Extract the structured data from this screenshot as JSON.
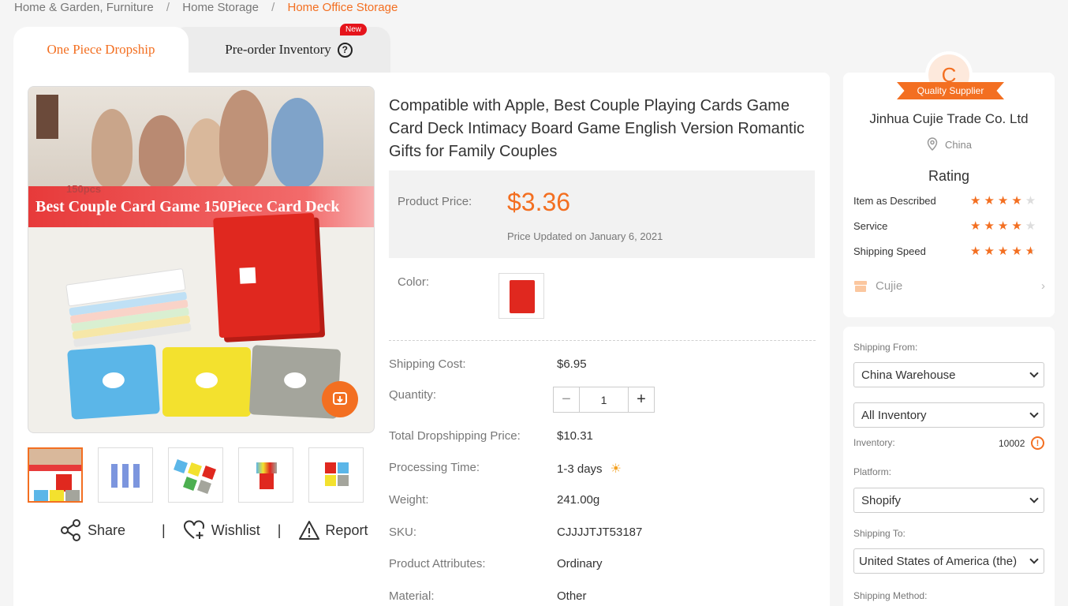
{
  "breadcrumb": {
    "items": [
      "Home & Garden, Furniture",
      "Home Storage"
    ],
    "current": "Home Office Storage",
    "separator": "/"
  },
  "tabs": {
    "dropship": "One Piece Dropship",
    "preorder": "Pre-order Inventory",
    "new_badge": "New"
  },
  "gallery": {
    "banner_text": "Best Couple Card Game 150Piece Card Deck",
    "banner_sub": "150pcs",
    "thumbnails": [
      "thumb-1",
      "thumb-2",
      "thumb-3",
      "thumb-4",
      "thumb-5"
    ]
  },
  "actions": {
    "share": "Share",
    "wishlist": "Wishlist",
    "report": "Report",
    "divider": "|"
  },
  "product": {
    "title": "Compatible with Apple, Best Couple Playing Cards Game Card Deck Intimacy Board Game English Version Romantic Gifts for Family Couples",
    "price_label": "Product Price:",
    "price": "$3.36",
    "price_updated": "Price Updated on January 6, 2021",
    "color_label": "Color:",
    "shipping_cost_label": "Shipping Cost:",
    "shipping_cost": "$6.95",
    "quantity_label": "Quantity:",
    "quantity": "1",
    "total_label": "Total Dropshipping Price:",
    "total": "$10.31",
    "processing_label": "Processing Time:",
    "processing": "1-3 days",
    "weight_label": "Weight:",
    "weight": "241.00g",
    "sku_label": "SKU:",
    "sku": "CJJJJTJT53187",
    "attributes_label": "Product Attributes:",
    "attributes": "Ordinary",
    "material_label": "Material:",
    "material": "Other"
  },
  "supplier": {
    "badge_letter": "C",
    "badge_ribbon": "Quality Supplier",
    "name": "Jinhua Cujie Trade Co. Ltd",
    "location": "China",
    "rating_title": "Rating",
    "ratings": [
      {
        "label": "Item as Described",
        "stars": 4
      },
      {
        "label": "Service",
        "stars": 4
      },
      {
        "label": "Shipping Speed",
        "stars": 4.5
      }
    ],
    "store": "Cujie"
  },
  "shipping": {
    "from_label": "Shipping From:",
    "from": "China Warehouse",
    "inventory_type": "All Inventory",
    "inventory_label": "Inventory:",
    "inventory": "10002",
    "platform_label": "Platform:",
    "platform": "Shopify",
    "to_label": "Shipping To:",
    "to": "United States of America (the)",
    "method_label": "Shipping Method:"
  },
  "colors": {
    "accent": "#f36f21",
    "badge_red": "#e5141b",
    "background": "#f5f5f5"
  }
}
